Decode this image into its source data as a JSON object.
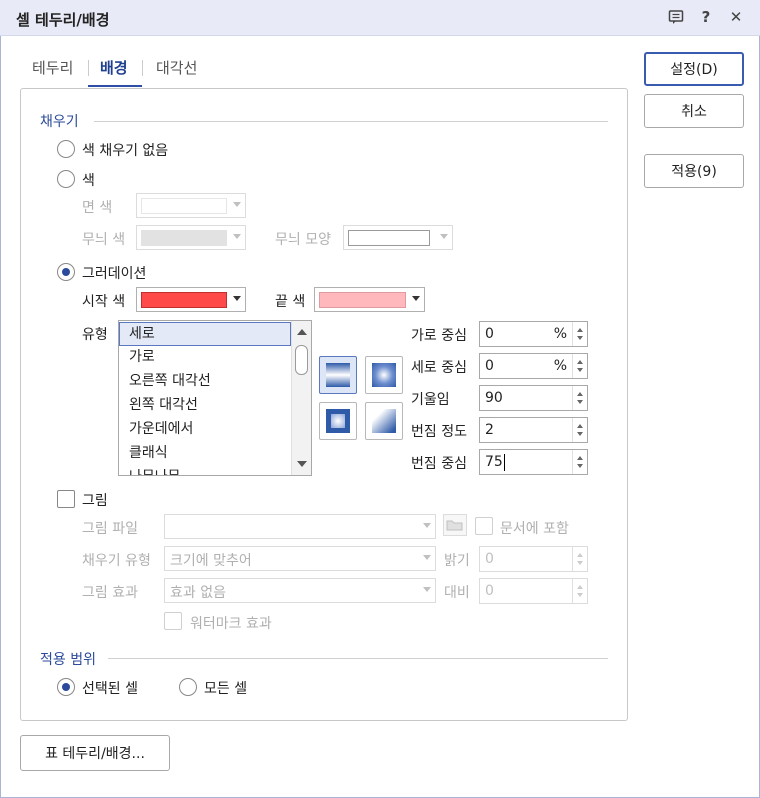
{
  "window": {
    "title": "셀 테두리/배경",
    "icons": [
      "comment-icon",
      "help-icon",
      "close-icon"
    ],
    "help_glyph": "?",
    "close_glyph": "✕"
  },
  "tabs": [
    {
      "label": "테두리",
      "active": false
    },
    {
      "label": "배경",
      "active": true
    },
    {
      "label": "대각선",
      "active": false
    }
  ],
  "buttons": {
    "ok": "설정(D)",
    "cancel": "취소",
    "apply": "적용(9)",
    "table_border": "표 테두리/배경..."
  },
  "fill": {
    "section_title": "채우기",
    "none_label": "색 채우기 없음",
    "color_label": "색",
    "face_color_label": "면 색",
    "pattern_color_label": "무늬 색",
    "pattern_shape_label": "무늬 모양",
    "gradient_label": "그러데이션",
    "start_color_label": "시작 색",
    "end_color_label": "끝 색",
    "start_color": "#ff4a4a",
    "end_color": "#ffb8bc",
    "type_label": "유형",
    "types": [
      "세로",
      "가로",
      "오른쪽 대각선",
      "왼쪽 대각선",
      "가운데에서",
      "클래식",
      "나무나무"
    ],
    "selected_type": "세로",
    "h_center_label": "가로 중심",
    "h_center_value": "0",
    "v_center_label": "세로 중심",
    "v_center_value": "0",
    "percent": "%",
    "tilt_label": "기울임",
    "tilt_value": "90",
    "blur_degree_label": "번짐 정도",
    "blur_degree_value": "2",
    "blur_center_label": "번짐 중심",
    "blur_center_value": "75",
    "preset_icons": [
      "gradient-vertical-icon",
      "gradient-radial-icon",
      "gradient-square-icon",
      "gradient-corner-icon"
    ],
    "gradient_blue": "#2e5aa8"
  },
  "picture": {
    "label": "그림",
    "file_label": "그림 파일",
    "include_label": "문서에 포함",
    "fill_type_label": "채우기 유형",
    "fill_type_value": "크기에 맞추어",
    "brightness_label": "밝기",
    "brightness_value": "0",
    "effect_label": "그림 효과",
    "effect_value": "효과 없음",
    "contrast_label": "대비",
    "contrast_value": "0",
    "watermark_label": "워터마크 효과"
  },
  "scope": {
    "section_title": "적용 범위",
    "selected_cells": "선택된 셀",
    "all_cells": "모든 셀"
  }
}
